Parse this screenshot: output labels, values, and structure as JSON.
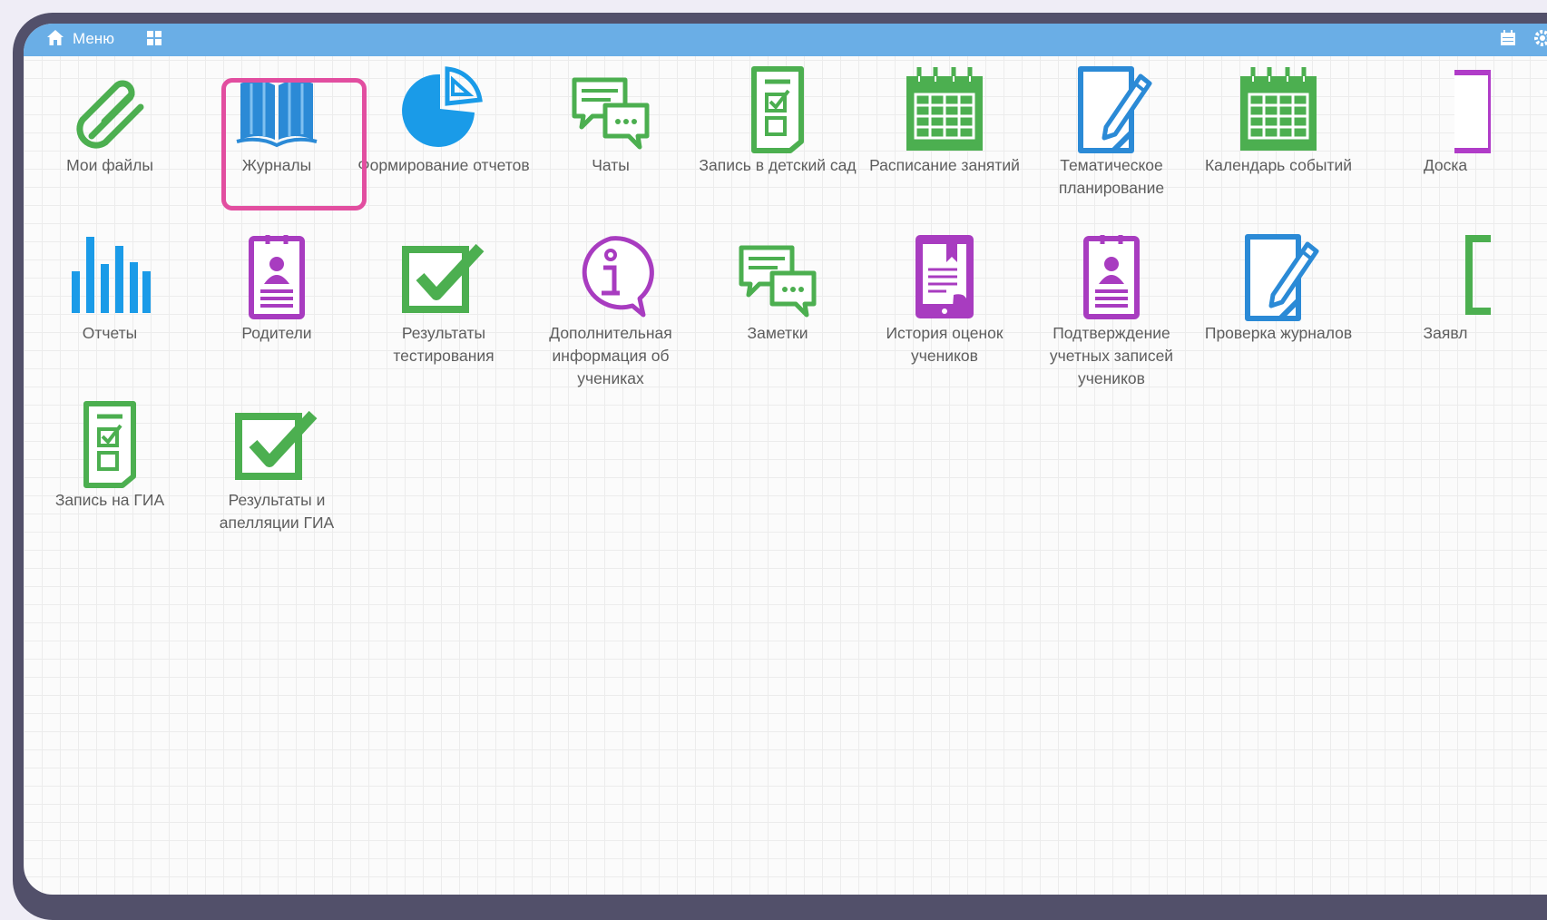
{
  "topbar": {
    "menu_label": "Меню",
    "color": "#6aaee6",
    "icons": [
      "home-icon",
      "apps-grid-icon",
      "calendar-icon",
      "gear-icon"
    ]
  },
  "highlight": {
    "target": "tile-journals",
    "color": "#e24ea0"
  },
  "tiles": [
    {
      "id": "my-files",
      "label": "Мои файлы",
      "icon": "paperclip-icon",
      "color": "#4caf50"
    },
    {
      "id": "journals",
      "label": "Журналы",
      "icon": "open-book-icon",
      "color": "#2b8ad6"
    },
    {
      "id": "report-builder",
      "label": "Формирование отчетов",
      "icon": "pie-chart-icon",
      "color": "#1a9be8"
    },
    {
      "id": "chats",
      "label": "Чаты",
      "icon": "chat-bubbles-icon",
      "color": "#4caf50"
    },
    {
      "id": "kindergarten",
      "label": "Запись в детский сад",
      "icon": "checklist-icon",
      "color": "#4caf50"
    },
    {
      "id": "schedule",
      "label": "Расписание занятий",
      "icon": "calendar-grid-icon",
      "color": "#4caf50"
    },
    {
      "id": "thematic-planning",
      "label": "Тематическое планирование",
      "icon": "document-pencil-icon",
      "color": "#2b8ad6"
    },
    {
      "id": "event-calendar",
      "label": "Календарь событий",
      "icon": "calendar-grid-icon",
      "color": "#4caf50"
    },
    {
      "id": "board",
      "label": "Доска",
      "icon": "board-icon",
      "color": "#b03cc8"
    },
    {
      "id": "reports",
      "label": "Отчеты",
      "icon": "bar-chart-icon",
      "color": "#1a9be8"
    },
    {
      "id": "parents",
      "label": "Родители",
      "icon": "id-card-icon",
      "color": "#a83cc0"
    },
    {
      "id": "test-results",
      "label": "Результаты тестирования",
      "icon": "checkbox-checked-icon",
      "color": "#4caf50"
    },
    {
      "id": "student-info",
      "label": "Дополнительная информация об учениках",
      "icon": "info-bubble-icon",
      "color": "#a83cc0"
    },
    {
      "id": "notes",
      "label": "Заметки",
      "icon": "chat-bubbles-icon",
      "color": "#4caf50"
    },
    {
      "id": "grade-history",
      "label": "История оценок учеников",
      "icon": "tablet-document-icon",
      "color": "#a83cc0"
    },
    {
      "id": "account-confirm",
      "label": "Подтверждение учетных записей учеников",
      "icon": "id-card-icon",
      "color": "#a83cc0"
    },
    {
      "id": "journal-check",
      "label": "Проверка журналов",
      "icon": "document-pencil-icon",
      "color": "#2b8ad6"
    },
    {
      "id": "applications",
      "label": "Заявл",
      "icon": "bracket-icon",
      "color": "#4caf50"
    },
    {
      "id": "gia-enroll",
      "label": "Запись на ГИА",
      "icon": "checklist-icon",
      "color": "#4caf50"
    },
    {
      "id": "gia-results",
      "label": "Результаты и апелляции ГИА",
      "icon": "checkbox-checked-icon",
      "color": "#4caf50"
    }
  ]
}
